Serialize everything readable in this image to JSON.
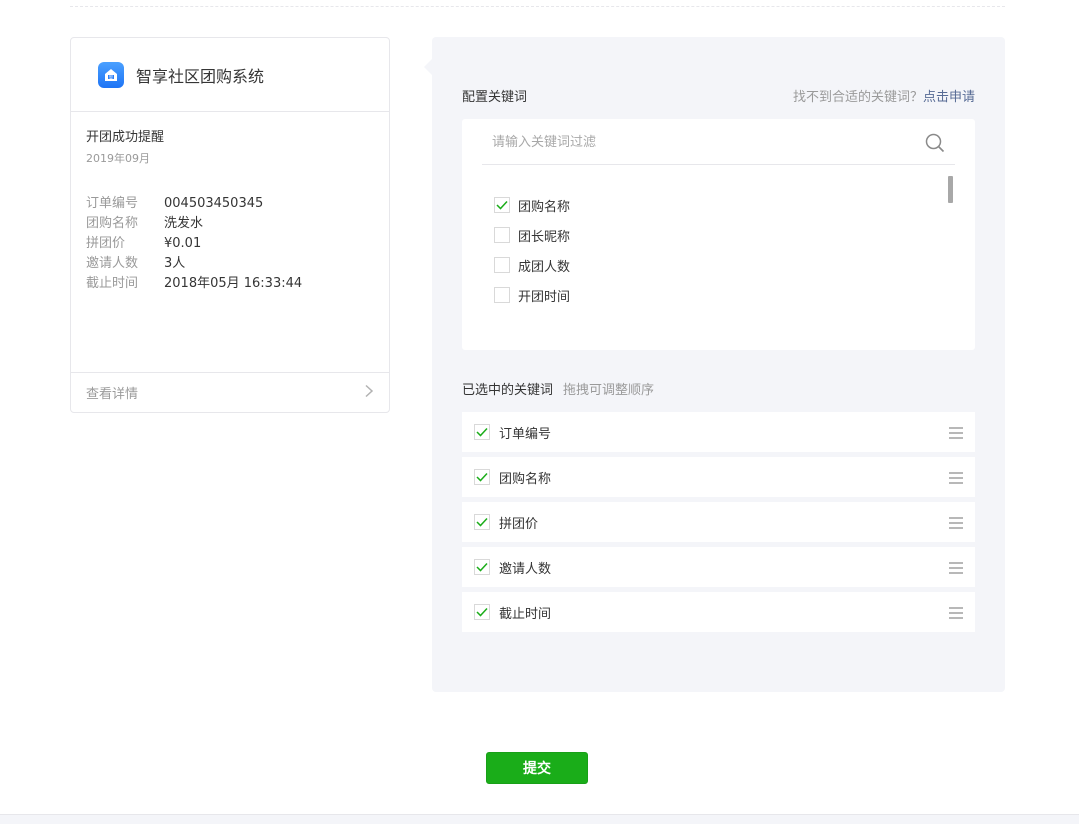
{
  "preview": {
    "app_name": "智享社区团购系统",
    "message_title": "开团成功提醒",
    "message_date": "2019年09月",
    "fields": [
      {
        "label": "订单编号",
        "value": "004503450345"
      },
      {
        "label": "团购名称",
        "value": "洗发水"
      },
      {
        "label": "拼团价",
        "value": "¥0.01"
      },
      {
        "label": "邀请人数",
        "value": "3人"
      },
      {
        "label": "截止时间",
        "value": "2018年05月 16:33:44"
      }
    ],
    "detail_link": "查看详情"
  },
  "config": {
    "title": "配置关键词",
    "apply_prompt": "找不到合适的关键词？",
    "apply_link": "点击申请",
    "search_placeholder": "请输入关键词过滤",
    "keywords": [
      {
        "label": "团购名称",
        "checked": true
      },
      {
        "label": "团长昵称",
        "checked": false
      },
      {
        "label": "成团人数",
        "checked": false
      },
      {
        "label": "开团时间",
        "checked": false
      }
    ],
    "selected_title": "已选中的关键词",
    "selected_hint": "拖拽可调整顺序",
    "selected": [
      {
        "label": "订单编号"
      },
      {
        "label": "团购名称"
      },
      {
        "label": "拼团价"
      },
      {
        "label": "邀请人数"
      },
      {
        "label": "截止时间"
      }
    ]
  },
  "submit_label": "提交",
  "colors": {
    "accent_green": "#1aad19",
    "link_blue": "#576b95",
    "panel_bg": "#f4f5f9"
  },
  "icons": {
    "app_logo": "app-logo-icon",
    "search": "search-icon",
    "chevron": "chevron-right-icon",
    "check": "check-icon",
    "drag": "drag-handle-icon"
  }
}
